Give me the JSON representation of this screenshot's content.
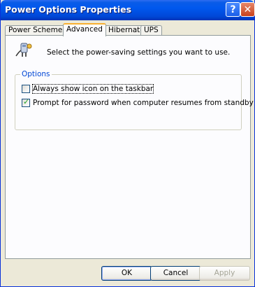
{
  "window": {
    "title": "Power Options Properties",
    "help_glyph": "?",
    "close_glyph": "✕",
    "accent_color": "#0058ee"
  },
  "tabs": [
    {
      "label": "Power Schemes",
      "active": false
    },
    {
      "label": "Advanced",
      "active": true
    },
    {
      "label": "Hibernate",
      "active": false
    },
    {
      "label": "UPS",
      "active": false
    }
  ],
  "advanced": {
    "intro_text": "Select the power-saving settings you want to use.",
    "options_group_label": "Options",
    "options": [
      {
        "label": "Always show icon on the taskbar",
        "checked": false
      },
      {
        "label": "Prompt for password when computer resumes from standby",
        "checked": true
      }
    ]
  },
  "buttons": {
    "ok": "OK",
    "cancel": "Cancel",
    "apply": "Apply"
  }
}
